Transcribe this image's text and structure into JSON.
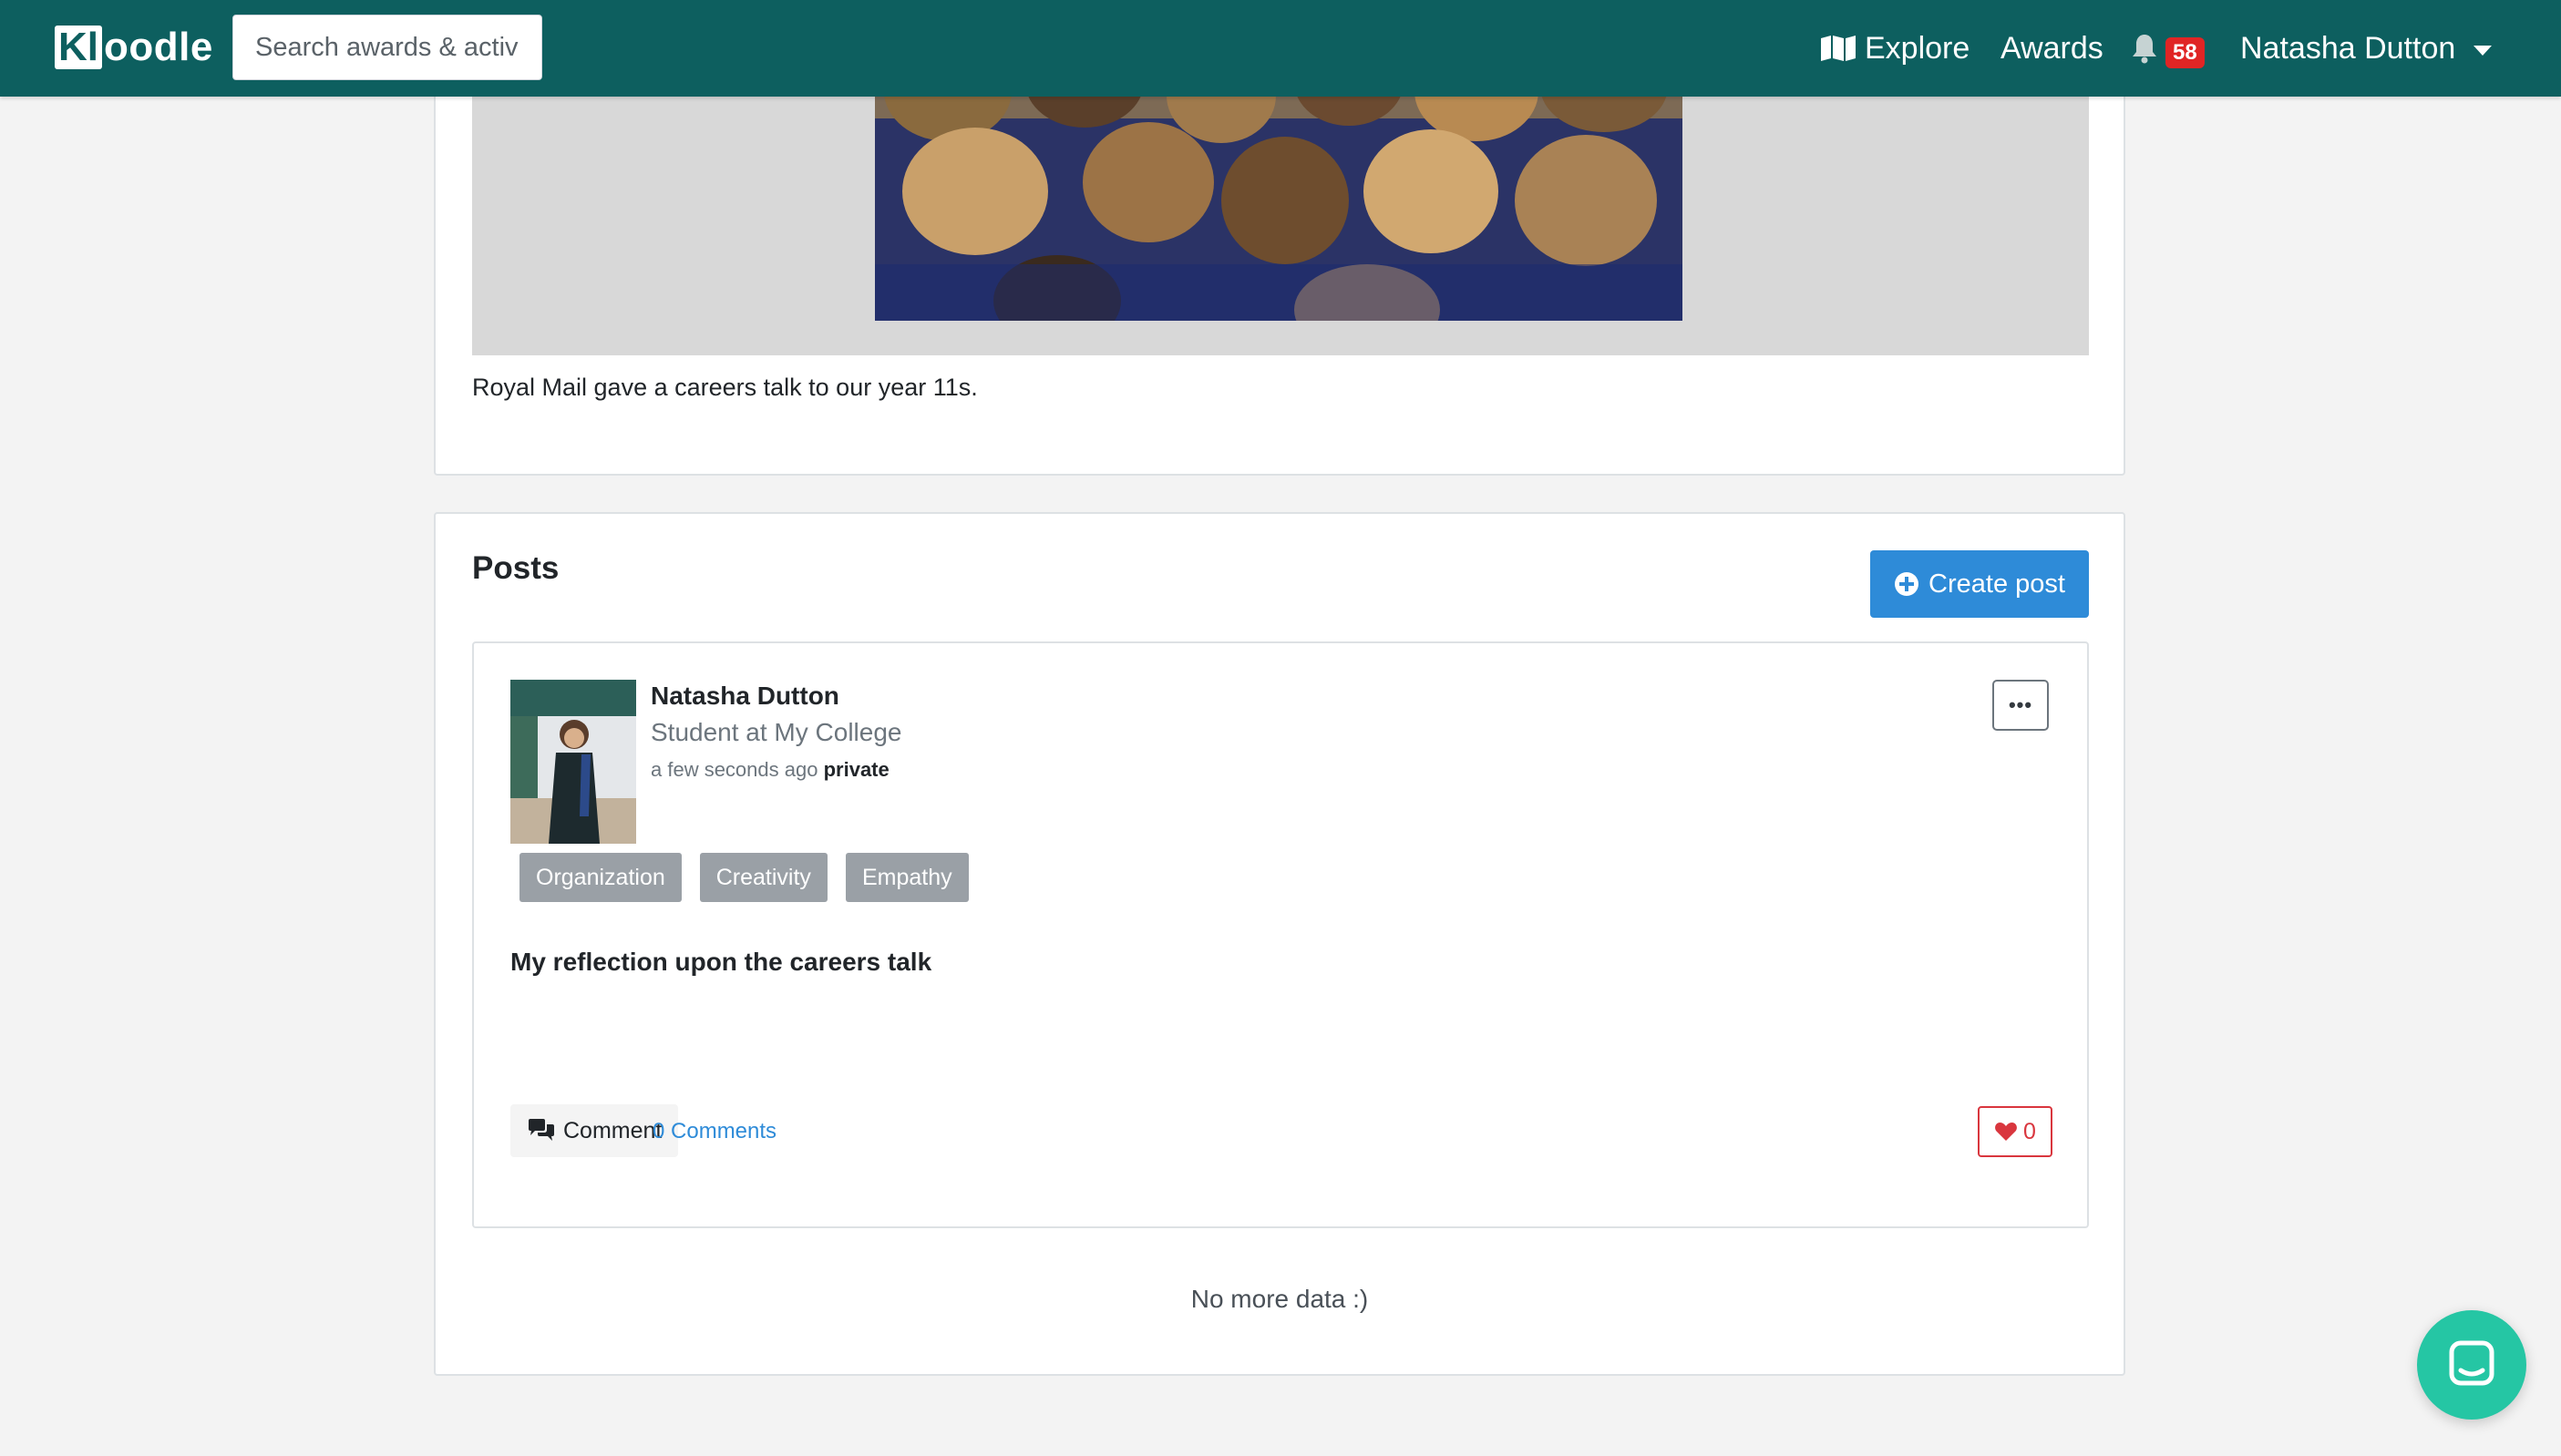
{
  "navbar": {
    "logo_box": "Kl",
    "logo_rest": "oodle",
    "search_placeholder": "Search awards & activities",
    "explore_label": "Explore",
    "awards_label": "Awards",
    "notification_count": "58",
    "user_name": "Natasha Dutton"
  },
  "activity": {
    "caption": "Royal Mail gave a careers talk to our year 11s."
  },
  "posts": {
    "section_title": "Posts",
    "create_post_label": "Create post",
    "items": [
      {
        "author": "Natasha Dutton",
        "role": "Student at My College",
        "time": "a few seconds ago",
        "visibility": "private",
        "tags": [
          "Organization",
          "Creativity",
          "Empathy"
        ],
        "title": "My reflection upon the careers talk",
        "comment_label": "Comment",
        "comments_count_label": "0 Comments",
        "likes": "0"
      }
    ],
    "end_message": "No more data :)"
  },
  "colors": {
    "navbar": "#0d5f5f",
    "primary": "#2e8bd8",
    "badge": "#e02525",
    "tag": "#9aa0a6",
    "like": "#d9363e",
    "chat": "#25c6a4"
  },
  "icons": {
    "explore": "map-icon",
    "notifications": "bell-icon",
    "user_menu": "caret-down-icon",
    "create": "plus-circle-icon",
    "post_menu": "more-icon",
    "comment": "comments-icon",
    "like": "heart-icon",
    "chat": "chat-icon"
  }
}
